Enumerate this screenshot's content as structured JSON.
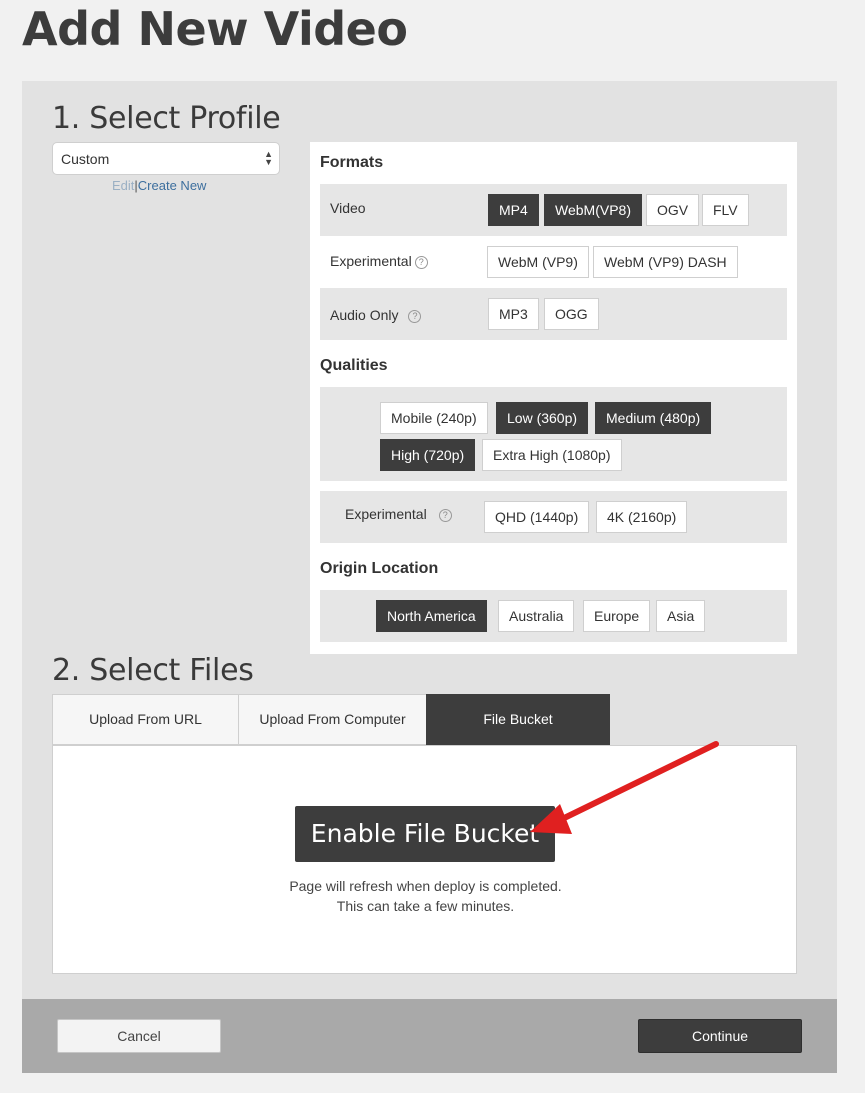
{
  "page": {
    "title": "Add New Video"
  },
  "profile": {
    "heading": "1. Select Profile",
    "selected": "Custom",
    "edit_link": "Edit",
    "separator": "|",
    "create_link": "Create New"
  },
  "formats": {
    "title": "Formats",
    "video": {
      "label": "Video",
      "options": [
        {
          "label": "MP4",
          "selected": true
        },
        {
          "label": "WebM(VP8)",
          "selected": true
        },
        {
          "label": "OGV",
          "selected": false
        },
        {
          "label": "FLV",
          "selected": false
        }
      ]
    },
    "experimental": {
      "label": "Experimental",
      "options": [
        {
          "label": "WebM (VP9)",
          "selected": false
        },
        {
          "label": "WebM (VP9) DASH",
          "selected": false
        }
      ]
    },
    "audio_only": {
      "label": "Audio Only",
      "options": [
        {
          "label": "MP3",
          "selected": false
        },
        {
          "label": "OGG",
          "selected": false
        }
      ]
    }
  },
  "qualities": {
    "title": "Qualities",
    "options": [
      {
        "label": "Mobile (240p)",
        "selected": false
      },
      {
        "label": "Low (360p)",
        "selected": true
      },
      {
        "label": "Medium (480p)",
        "selected": true
      },
      {
        "label": "High (720p)",
        "selected": true
      },
      {
        "label": "Extra High (1080p)",
        "selected": false
      }
    ],
    "experimental": {
      "label": "Experimental",
      "options": [
        {
          "label": "QHD (1440p)",
          "selected": false
        },
        {
          "label": "4K (2160p)",
          "selected": false
        }
      ]
    }
  },
  "origin": {
    "title": "Origin Location",
    "options": [
      {
        "label": "North America",
        "selected": true
      },
      {
        "label": "Australia",
        "selected": false
      },
      {
        "label": "Europe",
        "selected": false
      },
      {
        "label": "Asia",
        "selected": false
      }
    ]
  },
  "files": {
    "heading": "2. Select Files",
    "tabs": [
      {
        "label": "Upload From URL",
        "active": false
      },
      {
        "label": "Upload From Computer",
        "active": false
      },
      {
        "label": "File Bucket",
        "active": true
      }
    ],
    "enable_button": "Enable File Bucket",
    "note_line1": "Page will refresh when deploy is completed.",
    "note_line2": "This can take a few minutes."
  },
  "footer": {
    "cancel": "Cancel",
    "continue": "Continue"
  },
  "help_icon_glyph": "?",
  "colors": {
    "selected_chip": "#3d3d3d",
    "annotation_arrow": "#e02020"
  }
}
